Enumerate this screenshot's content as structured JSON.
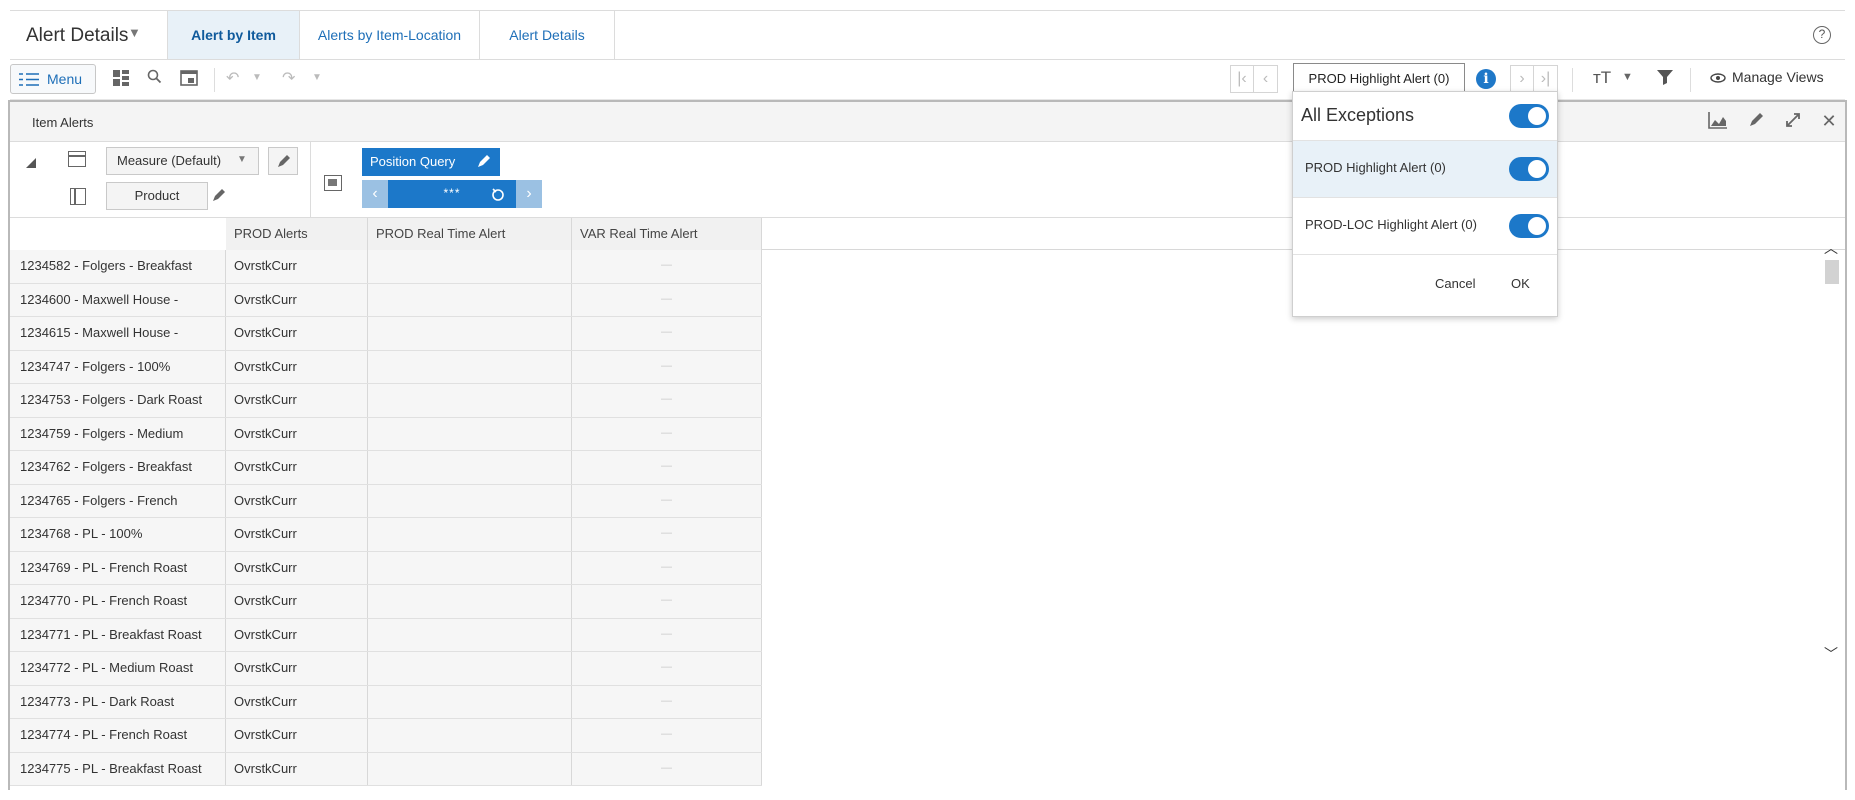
{
  "view": {
    "title": "Alert Details",
    "tabs": [
      "Alert by Item",
      "Alerts by Item-Location",
      "Alert Details"
    ]
  },
  "toolbar": {
    "menu_label": "Menu",
    "alert_selector": "PROD Highlight Alert (0)",
    "manage_views_label": "Manage Views"
  },
  "panel": {
    "title": "Item Alerts",
    "measure_label": "Measure (Default)",
    "product_label": "Product",
    "position_query_label": "Position Query",
    "position_value": "***"
  },
  "grid": {
    "columns": [
      "PROD Alerts",
      "PROD Real Time Alert",
      "VAR Real Time Alert"
    ],
    "rows": [
      {
        "name": "1234582 - Folgers - Breakfast",
        "prod": "OvrstkCurr",
        "rt": "",
        "var": "—"
      },
      {
        "name": "1234600 - Maxwell House -",
        "prod": "OvrstkCurr",
        "rt": "",
        "var": "—"
      },
      {
        "name": "1234615 - Maxwell House -",
        "prod": "OvrstkCurr",
        "rt": "",
        "var": "—"
      },
      {
        "name": "1234747 - Folgers - 100%",
        "prod": "OvrstkCurr",
        "rt": "",
        "var": "—"
      },
      {
        "name": "1234753 - Folgers - Dark Roast",
        "prod": "OvrstkCurr",
        "rt": "",
        "var": "—"
      },
      {
        "name": "1234759 - Folgers - Medium",
        "prod": "OvrstkCurr",
        "rt": "",
        "var": "—"
      },
      {
        "name": "1234762 - Folgers - Breakfast",
        "prod": "OvrstkCurr",
        "rt": "",
        "var": "—"
      },
      {
        "name": "1234765 - Folgers - French",
        "prod": "OvrstkCurr",
        "rt": "",
        "var": "—"
      },
      {
        "name": "1234768 - PL - 100%",
        "prod": "OvrstkCurr",
        "rt": "",
        "var": "—"
      },
      {
        "name": "1234769 - PL - French Roast",
        "prod": "OvrstkCurr",
        "rt": "",
        "var": "—"
      },
      {
        "name": "1234770 - PL - French Roast",
        "prod": "OvrstkCurr",
        "rt": "",
        "var": "—"
      },
      {
        "name": "1234771 - PL - Breakfast Roast",
        "prod": "OvrstkCurr",
        "rt": "",
        "var": "—"
      },
      {
        "name": "1234772 - PL - Medium Roast",
        "prod": "OvrstkCurr",
        "rt": "",
        "var": "—"
      },
      {
        "name": "1234773 - PL - Dark Roast",
        "prod": "OvrstkCurr",
        "rt": "",
        "var": "—"
      },
      {
        "name": "1234774 - PL - French Roast",
        "prod": "OvrstkCurr",
        "rt": "",
        "var": "—"
      },
      {
        "name": "1234775 - PL - Breakfast Roast",
        "prod": "OvrstkCurr",
        "rt": "",
        "var": "—"
      }
    ]
  },
  "popup": {
    "all_label": "All Exceptions",
    "all_on": true,
    "items": [
      {
        "label": "PROD Highlight Alert (0)",
        "on": true
      },
      {
        "label": "PROD-LOC Highlight Alert (0)",
        "on": true
      }
    ],
    "cancel_label": "Cancel",
    "ok_label": "OK"
  },
  "colors": {
    "accent": "#1c78c9",
    "selected_row": "#e8f1f8"
  }
}
